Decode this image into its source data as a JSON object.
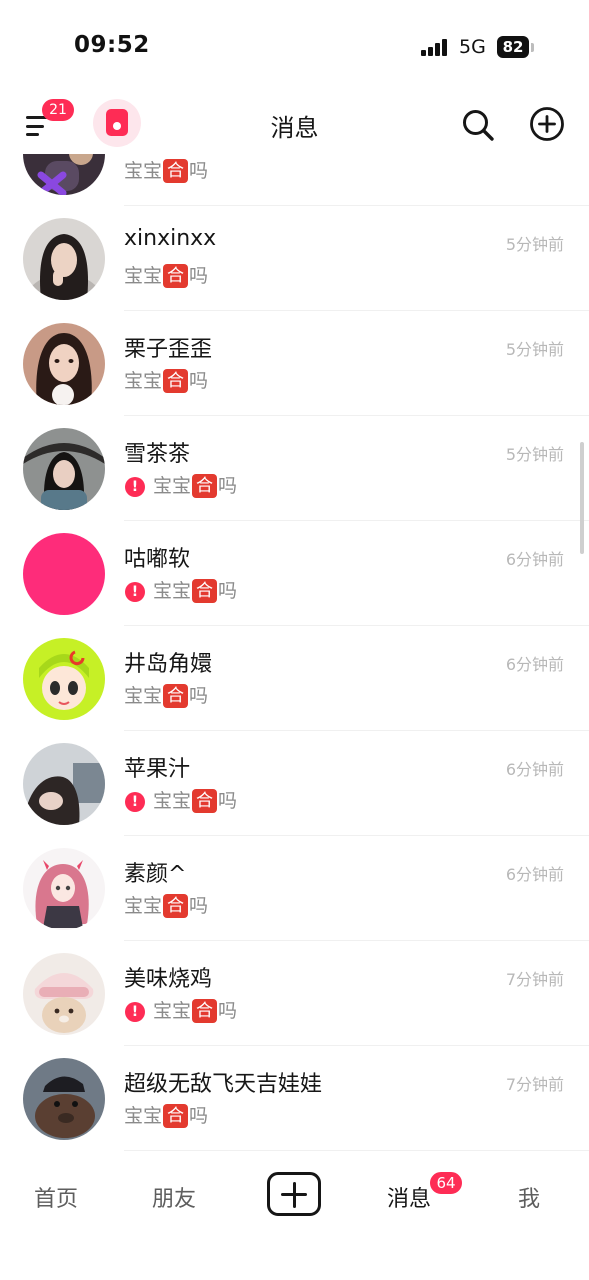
{
  "status_bar": {
    "time": "09:52",
    "network": "5G",
    "battery": "82"
  },
  "top_nav": {
    "title": "消息",
    "menu_badge": "21"
  },
  "partial_row": {
    "sub_prefix": "宝宝",
    "sub_highlight": "合",
    "sub_suffix": "吗"
  },
  "messages": [
    {
      "name": "xinxinxx",
      "time": "5分钟前",
      "sub_prefix": "宝宝",
      "sub_highlight": "合",
      "sub_suffix": "吗",
      "failed": false
    },
    {
      "name": "栗子歪歪",
      "time": "5分钟前",
      "sub_prefix": "宝宝",
      "sub_highlight": "合",
      "sub_suffix": "吗",
      "failed": false
    },
    {
      "name": "雪茶茶",
      "time": "5分钟前",
      "sub_prefix": "宝宝",
      "sub_highlight": "合",
      "sub_suffix": "吗",
      "failed": true
    },
    {
      "name": "咕嘟软",
      "time": "6分钟前",
      "sub_prefix": "宝宝",
      "sub_highlight": "合",
      "sub_suffix": "吗",
      "failed": true
    },
    {
      "name": "井岛角嬛",
      "time": "6分钟前",
      "sub_prefix": "宝宝",
      "sub_highlight": "合",
      "sub_suffix": "吗",
      "failed": false
    },
    {
      "name": "苹果汁",
      "time": "6分钟前",
      "sub_prefix": "宝宝",
      "sub_highlight": "合",
      "sub_suffix": "吗",
      "failed": true
    },
    {
      "name": "素颜^",
      "time": "6分钟前",
      "sub_prefix": "宝宝",
      "sub_highlight": "合",
      "sub_suffix": "吗",
      "failed": false
    },
    {
      "name": "美味烧鸡",
      "time": "7分钟前",
      "sub_prefix": "宝宝",
      "sub_highlight": "合",
      "sub_suffix": "吗",
      "failed": true
    },
    {
      "name": "超级无敌飞天吉娃娃",
      "time": "7分钟前",
      "sub_prefix": "宝宝",
      "sub_highlight": "合",
      "sub_suffix": "吗",
      "failed": false
    }
  ],
  "tab_bar": {
    "home": "首页",
    "friends": "朋友",
    "messages": "消息",
    "messages_badge": "64",
    "me": "我"
  },
  "colors": {
    "accent": "#fe2c55",
    "highlight_tag": "#e33a2f",
    "muted_text": "#8a8a8a",
    "time_text": "#b8b8b8"
  },
  "icons": [
    "menu-icon",
    "app-icon",
    "search-icon",
    "add-circle-icon",
    "send-failed-icon",
    "create-post-icon"
  ]
}
